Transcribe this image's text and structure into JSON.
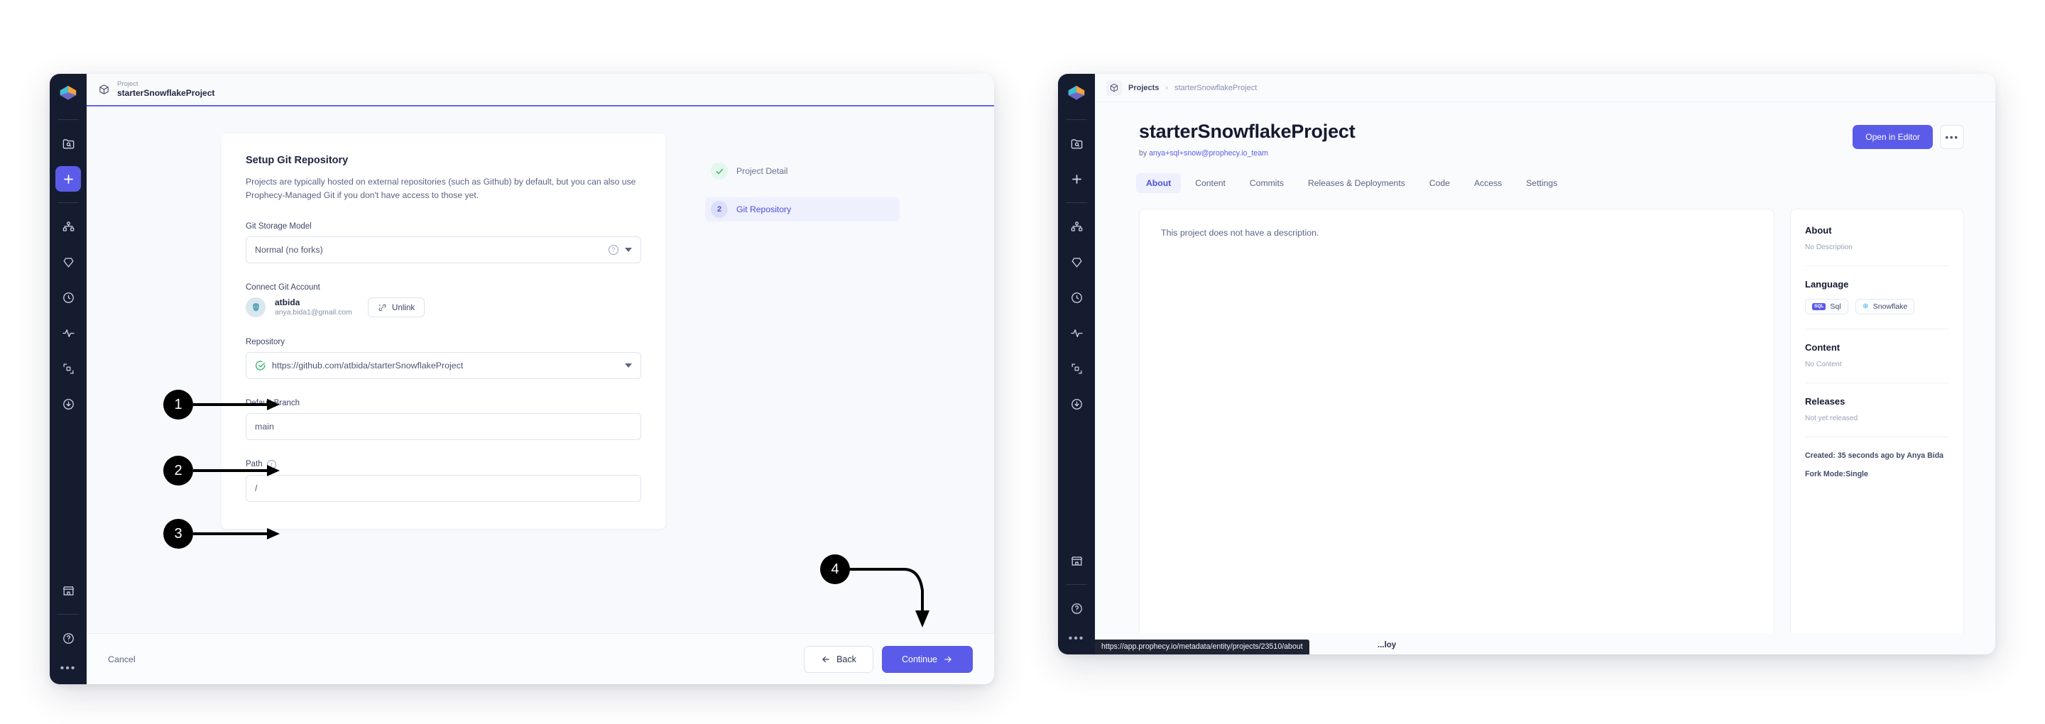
{
  "left_window": {
    "breadcrumb": {
      "kicker": "Project",
      "title": "starterSnowflakeProject"
    },
    "rail": {
      "logo": "prophecy-logo-icon",
      "items": [
        {
          "name": "search-folder-icon",
          "label": "Search"
        },
        {
          "name": "plus-icon",
          "label": "Create",
          "active": true
        },
        {
          "name": "pipeline-icon",
          "label": "Pipelines"
        },
        {
          "name": "gem-icon",
          "label": "Gems"
        },
        {
          "name": "clock-icon",
          "label": "History"
        },
        {
          "name": "activity-icon",
          "label": "Monitoring"
        },
        {
          "name": "fabric-icon",
          "label": "Fabrics"
        },
        {
          "name": "download-icon",
          "label": "Deployments"
        },
        {
          "name": "marketplace-icon",
          "label": "Marketplace"
        },
        {
          "name": "help-icon",
          "label": "Help"
        },
        {
          "name": "more-icon",
          "label": "More"
        }
      ]
    },
    "form": {
      "title": "Setup Git Repository",
      "description": "Projects are typically hosted on external repositories (such as Github) by default, but you can also use Prophecy-Managed Git if you don't have access to those yet.",
      "git_storage_model": {
        "label": "Git Storage Model",
        "value": "Normal (no forks)"
      },
      "connect_git_account": {
        "label": "Connect Git Account",
        "username": "atbida",
        "email": "anya.bida1@gmail.com",
        "unlink_label": "Unlink"
      },
      "repository": {
        "label": "Repository",
        "value": "https://github.com/atbida/starterSnowflakeProject"
      },
      "default_branch": {
        "label": "Default Branch",
        "value": "main"
      },
      "path": {
        "label": "Path",
        "value": "/"
      }
    },
    "steps": [
      {
        "badge": "check",
        "label": "Project Detail",
        "state": "done"
      },
      {
        "badge": "2",
        "label": "Git Repository",
        "state": "current"
      }
    ],
    "footer": {
      "cancel": "Cancel",
      "back": "Back",
      "continue": "Continue"
    }
  },
  "right_window": {
    "breadcrumb": {
      "root": "Projects",
      "sep": "›",
      "current": "starterSnowflakeProject"
    },
    "title": "starterSnowflakeProject",
    "by_prefix": "by ",
    "by_author": "anya+sql+snow@prophecy.io_team",
    "actions": {
      "open_in_editor": "Open in Editor",
      "kebab": "•••"
    },
    "tabs": [
      {
        "label": "About",
        "active": true
      },
      {
        "label": "Content",
        "active": false
      },
      {
        "label": "Commits",
        "active": false
      },
      {
        "label": "Releases & Deployments",
        "active": false
      },
      {
        "label": "Code",
        "active": false
      },
      {
        "label": "Access",
        "active": false
      },
      {
        "label": "Settings",
        "active": false
      }
    ],
    "main": {
      "description": "This project does not have a description."
    },
    "side": {
      "about_heading": "About",
      "about_value": "No Description",
      "language_heading": "Language",
      "languages": [
        {
          "label": "Sql",
          "icon": "sql-badge-icon"
        },
        {
          "label": "Snowflake",
          "icon": "snowflake-icon"
        }
      ],
      "content_heading": "Content",
      "content_value": "No Content",
      "releases_heading": "Releases",
      "releases_value": "Not yet released",
      "created": "Created: 35 seconds ago by Anya Bida",
      "fork_mode": "Fork Mode:Single"
    },
    "deploy_partial": "...loy",
    "status_url": "https://app.prophecy.io/metadata/entity/projects/23510/about"
  },
  "callouts": [
    {
      "number": "1",
      "target": "repository-input"
    },
    {
      "number": "2",
      "target": "default-branch-input"
    },
    {
      "number": "3",
      "target": "path-input"
    },
    {
      "number": "4",
      "target": "continue-button"
    }
  ],
  "colors": {
    "accent": "#5b5bea",
    "accent_soft": "#eef0fe",
    "rail_bg": "#161c30",
    "success": "#2cb36a",
    "page_bg": "#ffffff",
    "window_bg": "#f8f9fc"
  }
}
